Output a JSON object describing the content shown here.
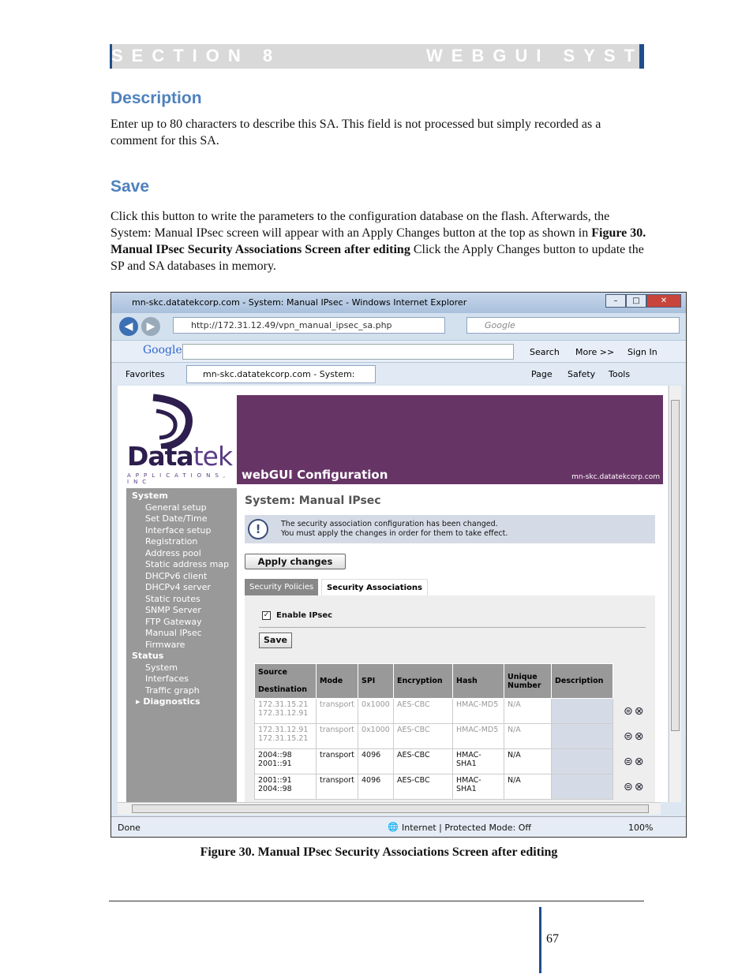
{
  "section": {
    "left": "SECTION 8",
    "right": "WEBGUI SYSTEM"
  },
  "description": {
    "heading": "Description",
    "text": "Enter up to 80 characters to describe this SA.  This field is not processed but simply recorded as a comment for this SA."
  },
  "save": {
    "heading": "Save",
    "text_before": "Click this button to write the parameters to the configuration database on the flash.  Afterwards, the System: Manual IPsec screen will appear with an Apply Changes button at the top as shown in ",
    "text_bold": "Figure 30. Manual IPsec Security Associations Screen after editing",
    "text_after": " Click the Apply Changes button to update the SP and SA databases in memory."
  },
  "browser": {
    "window_title": "mn-skc.datatekcorp.com - System: Manual IPsec - Windows Internet Explorer",
    "url": "http://172.31.12.49/vpn_manual_ipsec_sa.php",
    "search_placeholder": "Google",
    "google_label": "Google",
    "search_btn": "Search",
    "more_btn": "More >>",
    "signin": "Sign In",
    "favorites": "Favorites",
    "tab_title": "mn-skc.datatekcorp.com - System: Manual...",
    "page_menu": "Page",
    "safety_menu": "Safety",
    "tools_menu": "Tools",
    "status_left": "Done",
    "status_zone": "Internet | Protected Mode: Off",
    "zoom": "100%",
    "win_min": "–",
    "win_max": "□",
    "win_close": "✕"
  },
  "webgui": {
    "logo_main": "Data",
    "logo_em": "tek",
    "logo_sub": "APPLICATIONS, INC",
    "banner_title": "webGUI Configuration",
    "banner_host": "mn-skc.datatekcorp.com",
    "sidebar": {
      "system_head": "System",
      "system_items": [
        "General setup",
        "Set Date/Time",
        "Interface setup",
        "Registration",
        "Address pool",
        "Static address map",
        "DHCPv6 client",
        "DHCPv4 server",
        "Static routes",
        "SNMP Server",
        "FTP Gateway",
        "Manual IPsec",
        "Firmware"
      ],
      "status_head": "Status",
      "status_items": [
        "System",
        "Interfaces",
        "Traffic graph"
      ],
      "diag_head": "Diagnostics"
    },
    "page_title": "System: Manual IPsec",
    "notice_icon": "!",
    "notice_line1": "The security association configuration has been changed.",
    "notice_line2": "You must apply the changes in order for them to take effect.",
    "apply_btn": "Apply changes",
    "tab_policies": "Security Policies",
    "tab_associations": "Security Associations",
    "enable_label": "Enable IPsec",
    "check_mark": "✓",
    "save_btn": "Save",
    "table": {
      "headers": {
        "source": "Source",
        "destination": "Destination",
        "mode": "Mode",
        "spi": "SPI",
        "encryption": "Encryption",
        "hash": "Hash",
        "unique": "Unique Number",
        "description": "Description"
      },
      "rows": [
        {
          "src": "172.31.15.21",
          "dst": "172.31.12.91",
          "mode": "transport",
          "spi": "0x1000",
          "enc": "AES-CBC",
          "hash": "HMAC-MD5",
          "uniq": "N/A",
          "desc": ""
        },
        {
          "src": "172.31.12.91",
          "dst": "172.31.15.21",
          "mode": "transport",
          "spi": "0x1000",
          "enc": "AES-CBC",
          "hash": "HMAC-MD5",
          "uniq": "N/A",
          "desc": ""
        },
        {
          "src": "2004::98",
          "dst": "2001::91",
          "mode": "transport",
          "spi": "4096",
          "enc": "AES-CBC",
          "hash": "HMAC-SHA1",
          "uniq": "N/A",
          "desc": ""
        },
        {
          "src": "2001::91",
          "dst": "2004::98",
          "mode": "transport",
          "spi": "4096",
          "enc": "AES-CBC",
          "hash": "HMAC-SHA1",
          "uniq": "N/A",
          "desc": ""
        }
      ],
      "row_icons": "⊜⊗"
    }
  },
  "figure_caption": "Figure 30. Manual IPsec Security Associations Screen after editing",
  "page_number": "67"
}
